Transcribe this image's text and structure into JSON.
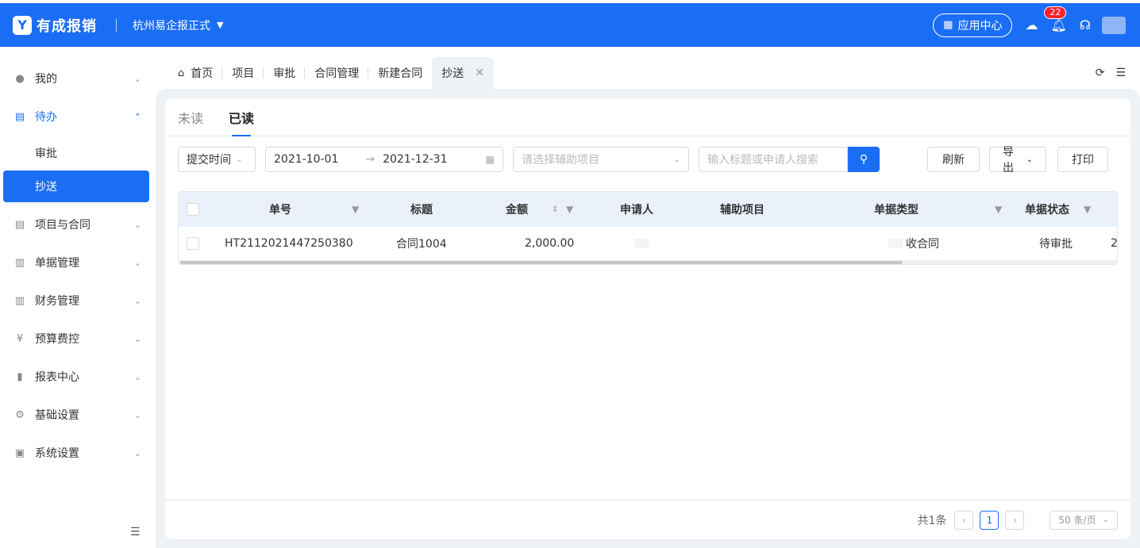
{
  "header": {
    "brand": "有成报销",
    "company": "杭州易企报正式",
    "app_center": "应用中心",
    "notify_count": "22"
  },
  "sidebar": {
    "items": [
      {
        "label": "我的"
      },
      {
        "label": "待办"
      },
      {
        "label": "项目与合同"
      },
      {
        "label": "单据管理"
      },
      {
        "label": "财务管理"
      },
      {
        "label": "预算费控"
      },
      {
        "label": "报表中心"
      },
      {
        "label": "基础设置"
      },
      {
        "label": "系统设置"
      }
    ],
    "sub_items": [
      {
        "label": "审批"
      },
      {
        "label": "抄送"
      }
    ]
  },
  "tabs": [
    {
      "label": "首页"
    },
    {
      "label": "项目"
    },
    {
      "label": "审批"
    },
    {
      "label": "合同管理"
    },
    {
      "label": "新建合同"
    },
    {
      "label": "抄送"
    }
  ],
  "read_tabs": {
    "unread": "未读",
    "read": "已读"
  },
  "filters": {
    "time_type": "提交时间",
    "date_start": "2021-10-01",
    "date_sep": "→",
    "date_end": "2021-12-31",
    "aux_placeholder": "请选择辅助项目",
    "search_placeholder": "输入标题或申请人搜索"
  },
  "actions": {
    "refresh": "刷新",
    "export": "导出",
    "print": "打印"
  },
  "table": {
    "columns": [
      "单号",
      "标题",
      "金额",
      "申请人",
      "辅助项目",
      "单据类型",
      "单据状态"
    ],
    "rows": [
      {
        "number": "HT2112021447250380",
        "title": "合同1004",
        "amount": "2,000.00",
        "type": "收合同",
        "status": "待审批",
        "extra": "2"
      }
    ]
  },
  "pagination": {
    "total": "共1条",
    "current": "1",
    "page_size": "50 条/页"
  }
}
